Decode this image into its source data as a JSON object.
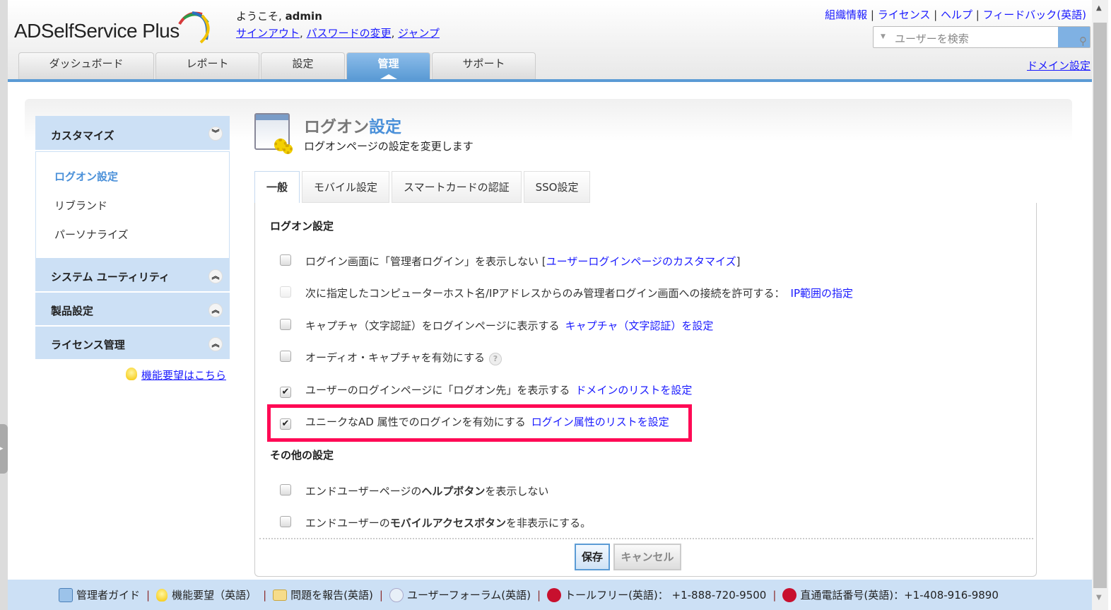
{
  "header": {
    "logo": "ADSelfService Plus",
    "welcome_prefix": "ようこそ,",
    "username": "admin",
    "user_links": [
      "サインアウト",
      "パスワードの変更",
      "ジャンプ"
    ],
    "top_links": [
      "組織情報",
      "ライセンス",
      "ヘルプ",
      "フィードバック(英語)"
    ],
    "search_placeholder": "ユーザーを検索",
    "domain_settings": "ドメイン設定",
    "tabs": [
      "ダッシュボード",
      "レポート",
      "設定",
      "管理",
      "サポート"
    ]
  },
  "sidebar": {
    "groups": [
      "カスタマイズ",
      "システム ユーティリティ",
      "製品設定",
      "ライセンス管理"
    ],
    "items": [
      "ログオン設定",
      "リブランド",
      "パーソナライズ"
    ],
    "feature_request": "機能要望はこちら"
  },
  "page": {
    "title_a": "ログオン",
    "title_b": "設定",
    "subtitle": "ログオンページの設定を変更します",
    "tabs": [
      "一般",
      "モバイル設定",
      "スマートカードの認証",
      "SSO設定"
    ],
    "section1": "ログオン設定",
    "section2": "その他の設定",
    "options": [
      {
        "text": "ログイン画面に「管理者ログイン」を表示しない",
        "link": "ユーザーログインページのカスタマイズ",
        "checked": false
      },
      {
        "text": "次に指定したコンピューターホスト名/IPアドレスからのみ管理者ログイン画面への接続を許可する：",
        "link": "IP範囲の指定",
        "checked": false,
        "disabled": true
      },
      {
        "text": "キャプチャ（文字認証）をログインページに表示する",
        "link": "キャプチャ（文字認証）を設定",
        "checked": false
      },
      {
        "text": "オーディオ・キャプチャを有効にする",
        "checked": false
      },
      {
        "text": "ユーザーのログインページに「ログオン先」を表示する",
        "link": "ドメインのリストを設定",
        "checked": true
      },
      {
        "text": "ユニークなAD 属性でのログインを有効にする",
        "link": "ログイン属性のリストを設定",
        "checked": true
      }
    ],
    "other_options": [
      {
        "pre": "エンドユーザーページの",
        "bold": "ヘルプボタン",
        "post": "を表示しない",
        "checked": false
      },
      {
        "pre": "エンドユーザーの",
        "bold": "モバイルアクセスボタン",
        "post": "を非表示にする。",
        "checked": false
      }
    ],
    "save": "保存",
    "cancel": "キャンセル"
  },
  "footer": [
    "管理者ガイド",
    "機能要望（英語）",
    "問題を報告(英語)",
    "ユーザーフォーラム(英語)",
    "トールフリー(英語)： +1-888-720-9500",
    "直通電話番号(英語)：+1-408-916-9890"
  ],
  "colors": {
    "accent": "#5b9bd5",
    "highlight": "#ff0a55",
    "link": "#1a1aff",
    "sidebar": "#cce0f5"
  }
}
